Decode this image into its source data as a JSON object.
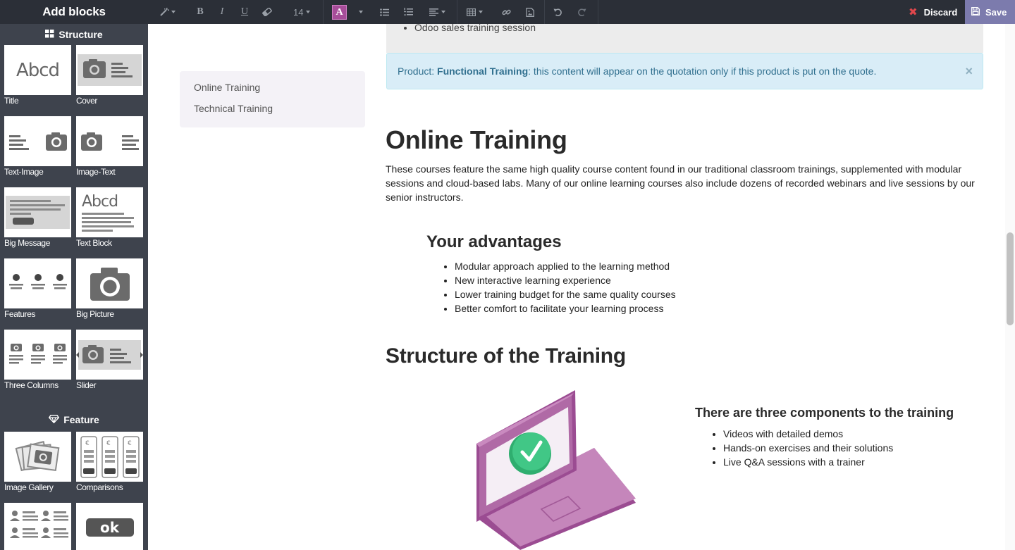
{
  "sidebar": {
    "title": "Add blocks",
    "sections": [
      {
        "title": "Structure",
        "blocks": [
          {
            "label": "Title"
          },
          {
            "label": "Cover"
          },
          {
            "label": "Text-Image"
          },
          {
            "label": "Image-Text"
          },
          {
            "label": "Big Message"
          },
          {
            "label": "Text Block"
          },
          {
            "label": "Features"
          },
          {
            "label": "Big Picture"
          },
          {
            "label": "Three Columns"
          },
          {
            "label": "Slider"
          }
        ]
      },
      {
        "title": "Feature",
        "blocks": [
          {
            "label": "Image Gallery"
          },
          {
            "label": "Comparisons"
          },
          {
            "label": ""
          },
          {
            "label": "",
            "thumb_text": "ok"
          }
        ]
      }
    ],
    "thumb_title_text": "Abcd"
  },
  "toolbar": {
    "font_size": "14",
    "font_color_letter": "A",
    "bold_letter": "B",
    "italic_letter": "I",
    "underline_letter": "U",
    "discard_label": "Discard",
    "save_label": "Save",
    "colors": {
      "font_color_swatch": "#a64d99",
      "save_bg": "#7c7bad",
      "discard_icon": "#e0474c"
    }
  },
  "content": {
    "prev_item": "Odoo sales training session",
    "alert": {
      "prefix": "Product: ",
      "product": "Functional Training",
      "suffix": ": this content will appear on the quotation only if this product is put on the quote.",
      "close": "×"
    },
    "toc": [
      "Online Training",
      "Technical Training"
    ],
    "heading": "Online Training",
    "intro": "These courses feature the same high quality course content found in our traditional classroom trainings, supplemented with modular sessions and cloud-based labs. Many of our online learning courses also include dozens of recorded webinars and live sessions by our senior instructors.",
    "advantages": {
      "title": "Your advantages",
      "items": [
        "Modular approach applied to the learning method",
        "New interactive learning experience",
        "Lower training budget for the same quality courses",
        "Better comfort to facilitate your learning process"
      ]
    },
    "structure_heading": "Structure of the Training",
    "components": {
      "title": "There are three components to the training",
      "items": [
        "Videos with detailed demos",
        "Hands-on exercises and their solutions",
        "Live Q&A sessions with a trainer"
      ]
    },
    "colors": {
      "laptop": "#a64d99",
      "check": "#3dbf83",
      "alert_bg": "#d9edf7",
      "toc_bg": "#f4f2f7"
    }
  }
}
